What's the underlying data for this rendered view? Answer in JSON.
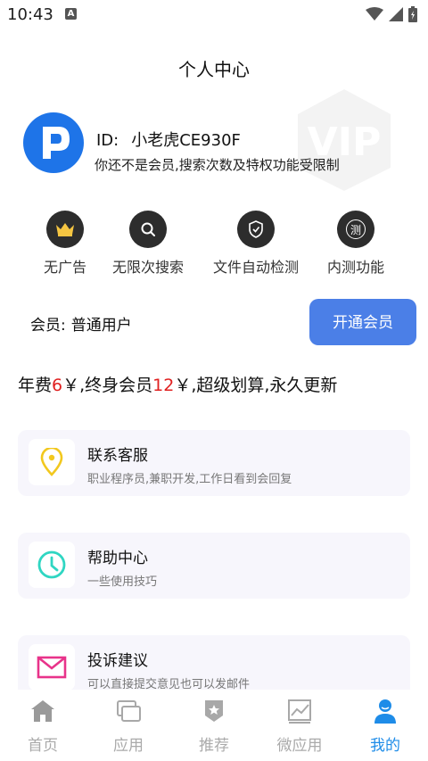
{
  "status_bar": {
    "time": "10:43",
    "notif_letter": "A"
  },
  "header": {
    "title": "个人中心"
  },
  "profile": {
    "id_label": "ID:",
    "username": "小老虎CE930F",
    "note": "你还不是会员,搜索次数及特权功能受限制",
    "watermark_text": "VIP"
  },
  "features": [
    {
      "label": "无广告",
      "icon": "crown-icon"
    },
    {
      "label": "无限次搜索",
      "icon": "search-icon"
    },
    {
      "label": "文件自动检测",
      "icon": "shield-icon"
    },
    {
      "label": "内测功能",
      "icon": "beta-icon",
      "glyph": "测"
    }
  ],
  "membership": {
    "label": "会员:",
    "value": "普通用户",
    "open_button": "开通会员"
  },
  "pricing": {
    "part1": "年费",
    "annual_price": "6",
    "part2": "￥,终身会员",
    "lifetime_price": "12",
    "part3": "￥,超级划算,永久更新"
  },
  "cards": [
    {
      "title": "联系客服",
      "subtitle": "职业程序员,兼职开发,工作日看到会回复",
      "icon": "location-pin-icon",
      "color": "#f2c81e"
    },
    {
      "title": "帮助中心",
      "subtitle": "一些使用技巧",
      "icon": "clock-icon",
      "color": "#2fd6c2"
    },
    {
      "title": "投诉建议",
      "subtitle": "可以直接提交意见也可以发邮件",
      "icon": "mail-icon",
      "color": "#e8338a"
    }
  ],
  "nav": [
    {
      "label": "首页",
      "icon": "home-icon",
      "active": false
    },
    {
      "label": "应用",
      "icon": "apps-icon",
      "active": false
    },
    {
      "label": "推荐",
      "icon": "recommend-icon",
      "active": false
    },
    {
      "label": "微应用",
      "icon": "chart-icon",
      "active": false
    },
    {
      "label": "我的",
      "icon": "user-icon",
      "active": true
    }
  ],
  "colors": {
    "accent": "#4b7fe7",
    "price_red": "#e02020",
    "nav_active": "#1e8ce8",
    "nav_inactive": "#aaaaaa"
  }
}
